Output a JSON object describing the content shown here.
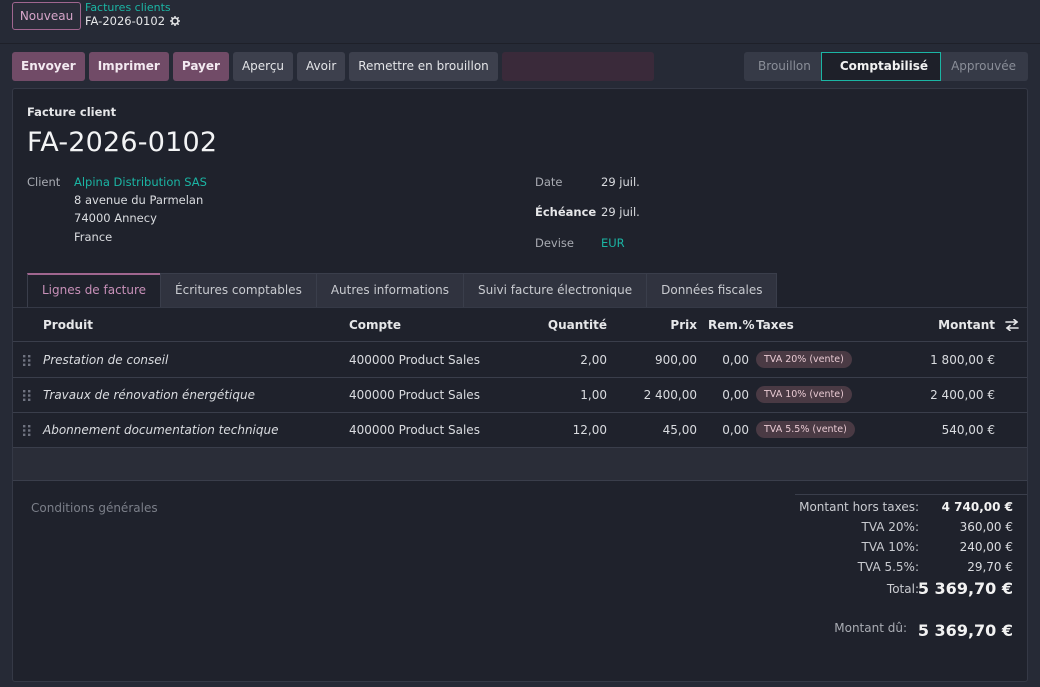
{
  "breadcrumb": {
    "new_label": "Nouveau",
    "parent": "Factures clients",
    "current": "FA-2026-0102",
    "settings_icon": "gear-icon"
  },
  "actions": {
    "send": "Envoyer",
    "print": "Imprimer",
    "pay": "Payer",
    "preview": "Aperçu",
    "credit_note": "Avoir",
    "reset_draft": "Remettre en brouillon"
  },
  "status": {
    "stages": [
      "Brouillon",
      "Comptabilisé",
      "Approuvée"
    ],
    "active": "Comptabilisé"
  },
  "form": {
    "kind": "Facture client",
    "number": "FA-2026-0102",
    "client_label": "Client",
    "client_name": "Alpina Distribution SAS",
    "address": [
      "8 avenue du Parmelan",
      "74000 Annecy",
      "France"
    ],
    "date_label": "Date",
    "date_value": "29 juil.",
    "due_label": "Échéance",
    "due_value": "29 juil.",
    "currency_label": "Devise",
    "currency_value": "EUR"
  },
  "tabs": [
    "Lignes de facture",
    "Écritures comptables",
    "Autres informations",
    "Suivi facture électronique",
    "Données fiscales"
  ],
  "table": {
    "headers": {
      "product": "Produit",
      "account": "Compte",
      "quantity": "Quantité",
      "price": "Prix",
      "discount": "Rem.%",
      "taxes": "Taxes",
      "amount": "Montant"
    },
    "rows": [
      {
        "product": "Prestation de conseil",
        "account": "400000 Product Sales",
        "quantity": "2,00",
        "price": "900,00",
        "discount": "0,00",
        "tax": "TVA 20% (vente)",
        "amount": "1 800,00 €"
      },
      {
        "product": "Travaux de rénovation énergétique",
        "account": "400000 Product Sales",
        "quantity": "1,00",
        "price": "2 400,00",
        "discount": "0,00",
        "tax": "TVA 10% (vente)",
        "amount": "2 400,00 €"
      },
      {
        "product": "Abonnement documentation technique",
        "account": "400000 Product Sales",
        "quantity": "12,00",
        "price": "45,00",
        "discount": "0,00",
        "tax": "TVA 5.5% (vente)",
        "amount": "540,00 €"
      }
    ]
  },
  "terms_placeholder": "Conditions générales",
  "totals": {
    "untaxed_label": "Montant hors taxes:",
    "untaxed_value": "4 740,00 €",
    "vat20_label": "TVA 20%:",
    "vat20_value": "360,00 €",
    "vat10_label": "TVA 10%:",
    "vat10_value": "240,00 €",
    "vat55_label": "TVA 5.5%:",
    "vat55_value": "29,70 €",
    "total_label": "Total:",
    "total_value": "5 369,70 €",
    "due_label": "Montant dû:",
    "due_value": "5 369,70 €"
  },
  "colors": {
    "accent": "#714B67",
    "link": "#1BB5A4",
    "background": "#262A36",
    "sheet": "#1F222C"
  }
}
